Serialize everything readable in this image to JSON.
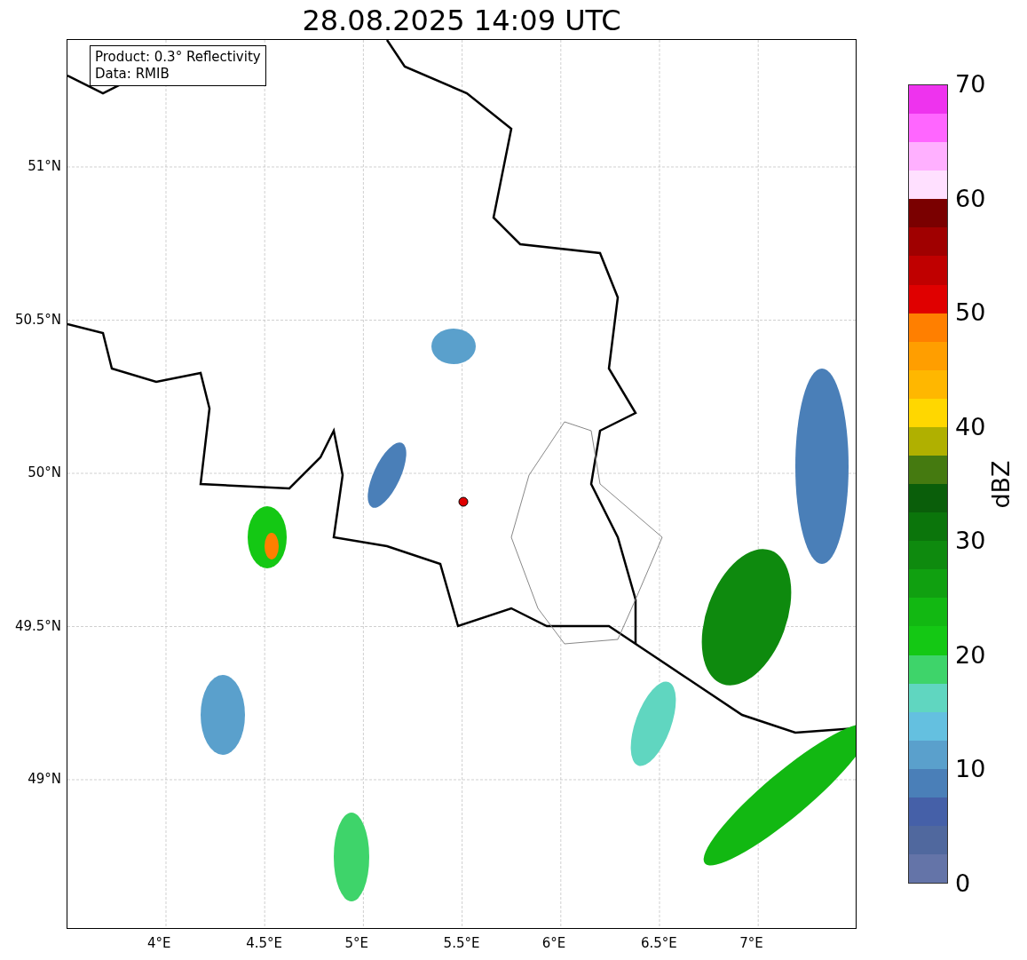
{
  "title": "28.08.2025 14:09 UTC",
  "map": {
    "legend": [
      "Product: 0.3° Reflectivity",
      "Data: RMIB"
    ],
    "x_ticks": [
      "4°E",
      "4.5°E",
      "5°E",
      "5.5°E",
      "6°E",
      "6.5°E",
      "7°E"
    ],
    "y_ticks": [
      "51°N",
      "50.5°N",
      "50°N",
      "49.5°N",
      "49°N"
    ]
  },
  "colorbar": {
    "label": "dBZ",
    "ticks": [
      "70",
      "60",
      "50",
      "40",
      "30",
      "20",
      "10",
      "0"
    ],
    "bins": [
      {
        "color": "#ee33ee"
      },
      {
        "color": "#ff66ff"
      },
      {
        "color": "#ffb0ff"
      },
      {
        "color": "#ffe0ff"
      },
      {
        "color": "#7a0000"
      },
      {
        "color": "#a00000"
      },
      {
        "color": "#c00000"
      },
      {
        "color": "#e00000"
      },
      {
        "color": "#ff7f00"
      },
      {
        "color": "#ff9e00"
      },
      {
        "color": "#ffb700"
      },
      {
        "color": "#ffd700"
      },
      {
        "color": "#b0b000"
      },
      {
        "color": "#457a10"
      },
      {
        "color": "#0a5e0a"
      },
      {
        "color": "#0b750b"
      },
      {
        "color": "#0e8a0e"
      },
      {
        "color": "#10a010"
      },
      {
        "color": "#12b812"
      },
      {
        "color": "#14c814"
      },
      {
        "color": "#3ed46a"
      },
      {
        "color": "#60d6c0"
      },
      {
        "color": "#64c0e0"
      },
      {
        "color": "#5aa0cc"
      },
      {
        "color": "#4a7fb8"
      },
      {
        "color": "#4560a8"
      },
      {
        "color": "#50689e"
      },
      {
        "color": "#6474a8"
      }
    ]
  }
}
